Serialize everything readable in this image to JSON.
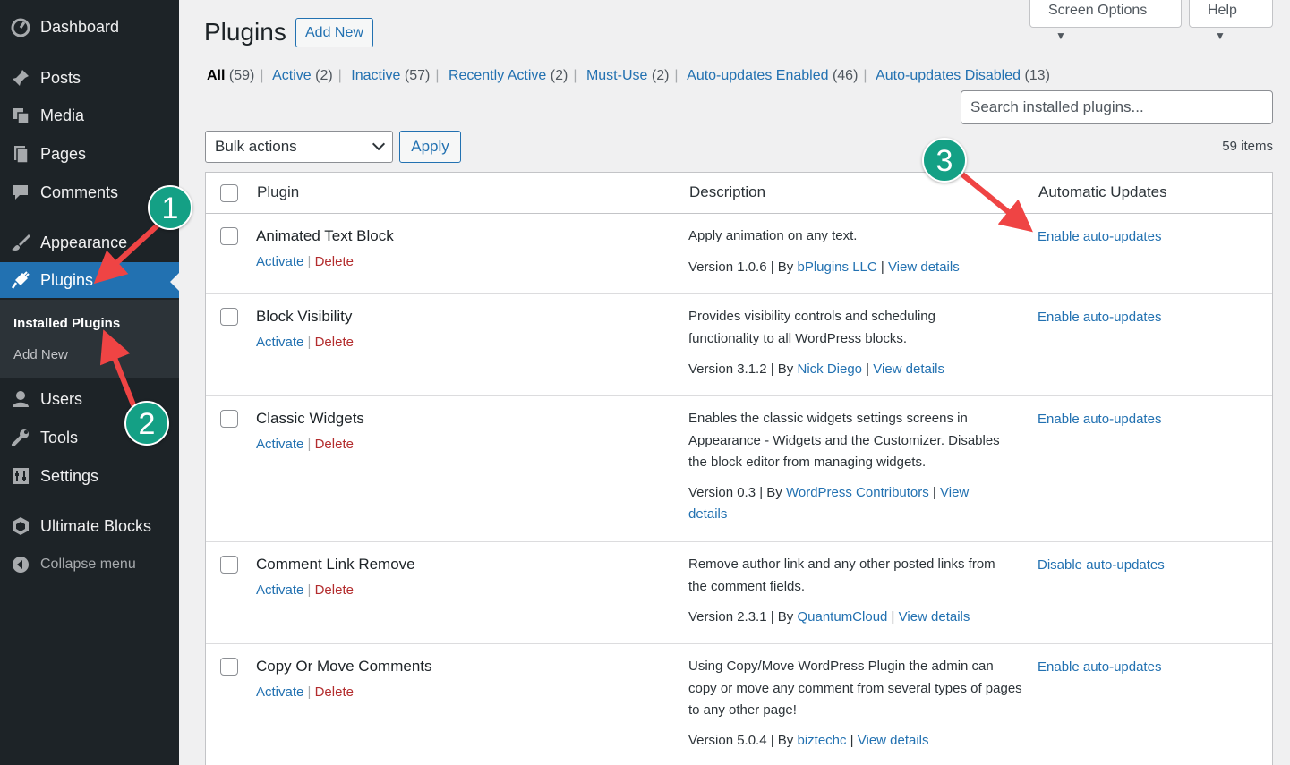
{
  "sidebar": {
    "items": [
      {
        "label": "Dashboard",
        "icon": "dashboard-icon"
      },
      {
        "label": "Posts",
        "icon": "pin-icon"
      },
      {
        "label": "Media",
        "icon": "media-icon"
      },
      {
        "label": "Pages",
        "icon": "pages-icon"
      },
      {
        "label": "Comments",
        "icon": "comment-icon"
      },
      {
        "label": "Appearance",
        "icon": "brush-icon"
      },
      {
        "label": "Plugins",
        "icon": "plugin-icon"
      },
      {
        "label": "Users",
        "icon": "users-icon"
      },
      {
        "label": "Tools",
        "icon": "wrench-icon"
      },
      {
        "label": "Settings",
        "icon": "settings-icon"
      },
      {
        "label": "Ultimate Blocks",
        "icon": "ultimate-blocks-icon"
      }
    ],
    "submenu": [
      {
        "label": "Installed Plugins"
      },
      {
        "label": "Add New"
      }
    ],
    "collapse_label": "Collapse menu",
    "accent_color": "#2271b1"
  },
  "header": {
    "title": "Plugins",
    "add_new_label": "Add New",
    "screen_options_label": "Screen Options",
    "help_label": "Help"
  },
  "filters": [
    {
      "label": "All",
      "count": "(59)"
    },
    {
      "label": "Active",
      "count": "(2)"
    },
    {
      "label": "Inactive",
      "count": "(57)"
    },
    {
      "label": "Recently Active",
      "count": "(2)"
    },
    {
      "label": "Must-Use",
      "count": "(2)"
    },
    {
      "label": "Auto-updates Enabled",
      "count": "(46)"
    },
    {
      "label": "Auto-updates Disabled",
      "count": "(13)"
    }
  ],
  "search": {
    "placeholder": "Search installed plugins..."
  },
  "bulk": {
    "selected": "Bulk actions",
    "apply_label": "Apply",
    "items_count": "59 items"
  },
  "table": {
    "columns": {
      "plugin": "Plugin",
      "description": "Description",
      "auto": "Automatic Updates"
    },
    "action_activate": "Activate",
    "action_delete": "Delete",
    "rows": [
      {
        "name": "Animated Text Block",
        "description": "Apply animation on any text.",
        "version": "Version 1.0.6",
        "by": "By",
        "author": "bPlugins LLC",
        "view": "View details",
        "auto": "Enable auto-updates"
      },
      {
        "name": "Block Visibility",
        "description": "Provides visibility controls and scheduling functionality to all WordPress blocks.",
        "version": "Version 3.1.2",
        "by": "By",
        "author": "Nick Diego",
        "view": "View details",
        "auto": "Enable auto-updates"
      },
      {
        "name": "Classic Widgets",
        "description": "Enables the classic widgets settings screens in Appearance - Widgets and the Customizer. Disables the block editor from managing widgets.",
        "version": "Version 0.3",
        "by": "By",
        "author": "WordPress Contributors",
        "view": "View details",
        "auto": "Enable auto-updates"
      },
      {
        "name": "Comment Link Remove",
        "description": "Remove author link and any other posted links from the comment fields.",
        "version": "Version 2.3.1",
        "by": "By",
        "author": "QuantumCloud",
        "view": "View details",
        "auto": "Disable auto-updates"
      },
      {
        "name": "Copy Or Move Comments",
        "description": "Using Copy/Move WordPress Plugin the admin can copy or move any comment from several types of pages to any other page!",
        "version": "Version 5.0.4",
        "by": "By",
        "author": "biztechc",
        "view": "View details",
        "auto": "Enable auto-updates"
      }
    ]
  },
  "annotations": {
    "badges": [
      "1",
      "2",
      "3"
    ],
    "badge_color": "#14a085",
    "arrow_color": "#ef4444"
  }
}
